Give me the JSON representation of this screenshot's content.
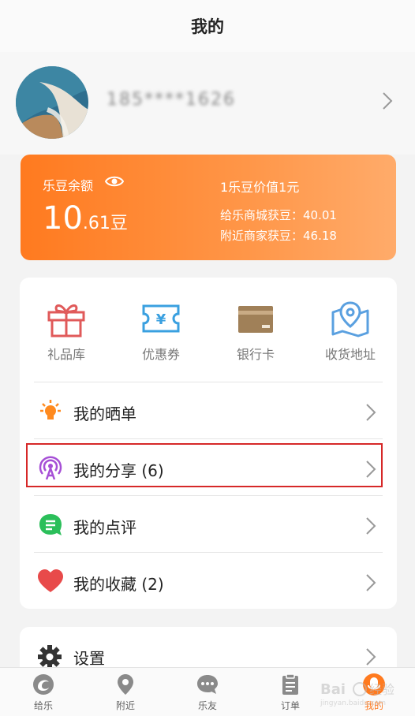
{
  "header": {
    "title": "我的"
  },
  "profile": {
    "phone": "185****1626"
  },
  "balance": {
    "label": "乐豆余额",
    "amount_int": "10",
    "amount_dec": ".61",
    "unit": "豆",
    "rate_text": "1乐豆价值1元",
    "mall_text": "给乐商城获豆：40.01",
    "nearby_text": "附近商家获豆：46.18"
  },
  "shortcuts": [
    {
      "label": "礼品库",
      "icon": "gift-icon",
      "color": "#e05a5a"
    },
    {
      "label": "优惠券",
      "icon": "coupon-icon",
      "color": "#3aa0e0"
    },
    {
      "label": "银行卡",
      "icon": "bank-card-icon",
      "color": "#a08058"
    },
    {
      "label": "收货地址",
      "icon": "location-icon",
      "color": "#5aa0e0"
    }
  ],
  "menu": [
    {
      "label": "我的晒单",
      "icon": "lamp-icon",
      "color": "#ff8a1f"
    },
    {
      "label": "我的分享 (6)",
      "icon": "broadcast-icon",
      "color": "#a64fd6"
    },
    {
      "label": "我的点评",
      "icon": "comment-icon",
      "color": "#2bbf5a"
    },
    {
      "label": "我的收藏 (2)",
      "icon": "heart-icon",
      "color": "#e84a4a"
    }
  ],
  "settings": {
    "label": "设置"
  },
  "tabs": [
    {
      "label": "给乐",
      "icon": "home-logo-icon"
    },
    {
      "label": "附近",
      "icon": "map-pin-icon"
    },
    {
      "label": "乐友",
      "icon": "chat-icon"
    },
    {
      "label": "订单",
      "icon": "clipboard-icon"
    },
    {
      "label": "我的",
      "icon": "user-icon",
      "active": true
    }
  ],
  "accent": "#ff7a1f"
}
